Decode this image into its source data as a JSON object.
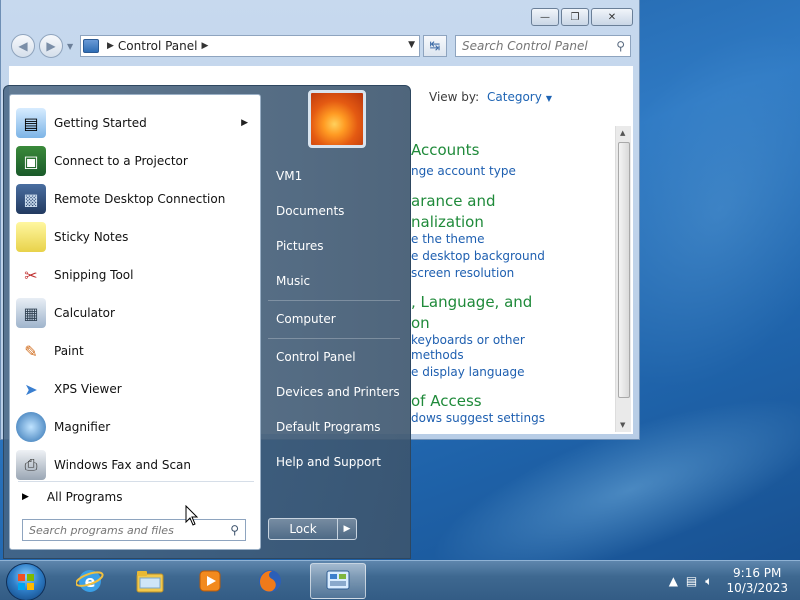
{
  "desktop": {},
  "control_panel": {
    "address": {
      "crumb": "Control Panel"
    },
    "search_placeholder": "Search Control Panel",
    "view_by_label": "View by:",
    "view_by_value": "Category",
    "categories": [
      {
        "heading": "Accounts",
        "links": [
          "nge account type"
        ]
      },
      {
        "heading_lines": [
          "arance and",
          "nalization"
        ],
        "links": [
          "e the theme",
          "e desktop background",
          "screen resolution"
        ]
      },
      {
        "heading_lines": [
          ", Language, and",
          "on"
        ],
        "links": [
          "keyboards or other",
          "methods",
          "e display language"
        ]
      },
      {
        "heading": "of Access",
        "links": [
          "dows suggest settings"
        ]
      }
    ]
  },
  "start_menu": {
    "programs": [
      {
        "label": "Getting Started",
        "icon": "getting-started-icon",
        "has_submenu": true
      },
      {
        "label": "Connect to a Projector",
        "icon": "projector-icon"
      },
      {
        "label": "Remote Desktop Connection",
        "icon": "remote-desktop-icon"
      },
      {
        "label": "Sticky Notes",
        "icon": "sticky-notes-icon"
      },
      {
        "label": "Snipping Tool",
        "icon": "snipping-tool-icon"
      },
      {
        "label": "Calculator",
        "icon": "calculator-icon"
      },
      {
        "label": "Paint",
        "icon": "paint-icon"
      },
      {
        "label": "XPS Viewer",
        "icon": "xps-viewer-icon"
      },
      {
        "label": "Magnifier",
        "icon": "magnifier-icon"
      },
      {
        "label": "Windows Fax and Scan",
        "icon": "fax-scan-icon"
      }
    ],
    "all_programs": "All Programs",
    "search_placeholder": "Search programs and files",
    "right_items": [
      "VM1",
      "Documents",
      "Pictures",
      "Music",
      "Computer",
      "Control Panel",
      "Devices and Printers",
      "Default Programs",
      "Help and Support"
    ],
    "lock_label": "Lock"
  },
  "taskbar": {
    "apps": [
      "internet-explorer-icon",
      "windows-explorer-icon",
      "media-player-icon",
      "firefox-icon",
      "control-panel-icon"
    ],
    "time": "9:16 PM",
    "date": "10/3/2023"
  }
}
